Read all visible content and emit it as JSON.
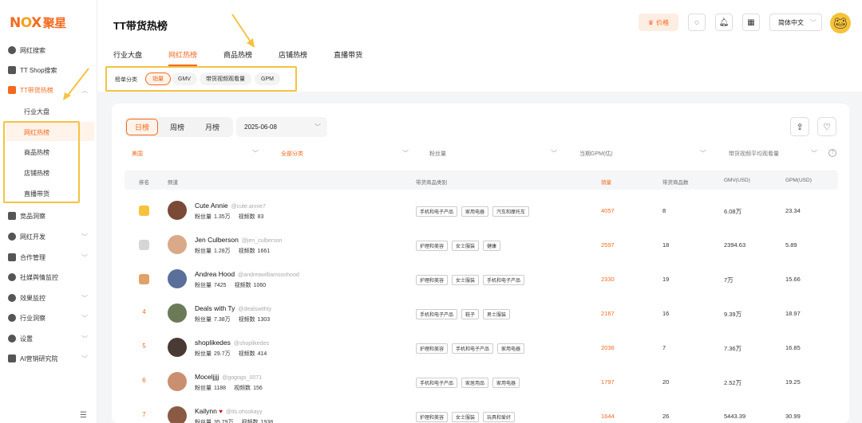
{
  "sidebar": {
    "logo_en": "NOX",
    "logo_cn": "聚星",
    "items": [
      {
        "label": "网红搜索",
        "icon": "compass-icon"
      },
      {
        "label": "TT Shop搜索",
        "icon": "shop-icon"
      },
      {
        "label": "TT带货热榜",
        "icon": "bar-chart-icon"
      },
      {
        "label": "竞品洞察",
        "icon": "r-badge-icon"
      },
      {
        "label": "网红开发",
        "icon": "users-icon"
      },
      {
        "label": "合作管理",
        "icon": "document-icon"
      },
      {
        "label": "社媒舆情监控",
        "icon": "monitor-icon"
      },
      {
        "label": "效果监控",
        "icon": "target-icon"
      },
      {
        "label": "行业洞察",
        "icon": "globe-icon"
      },
      {
        "label": "设置",
        "icon": "gear-icon"
      },
      {
        "label": "AI营销研究院",
        "icon": "ai-icon"
      }
    ],
    "sub_items": [
      "行业大盘",
      "网红热榜",
      "商品热榜",
      "店铺热榜",
      "直播带货"
    ]
  },
  "header": {
    "title": "TT带货热榜",
    "tabs": [
      "行业大盘",
      "网红热榜",
      "商品热榜",
      "店铺热榜",
      "直播带货"
    ],
    "price_label": "价格",
    "language": "简体中文"
  },
  "filter": {
    "label": "榜单分类",
    "chips": [
      "销量",
      "GMV",
      "带货视频观看量",
      "GPM"
    ]
  },
  "controls": {
    "periods": [
      "日榜",
      "周榜",
      "月榜"
    ],
    "date": "2025-06-08",
    "dropdowns": [
      "美国",
      "全部分类",
      "粉丝量",
      "当期GPM(估)",
      "带货视频平均观看量"
    ]
  },
  "table": {
    "headers": [
      "排名",
      "频道",
      "带货商品类别",
      "销量",
      "带货商品数",
      "GMV(USD)",
      "GPM(USD)"
    ],
    "fans_label": "粉丝量",
    "videos_label": "视频数",
    "rows": [
      {
        "rank": "1",
        "name": "Cute Annie",
        "handle": "@cute.annie7",
        "fans": "1.35万",
        "videos": "83",
        "tags": [
          "手机和电子产品",
          "家用电器",
          "汽车和摩托车"
        ],
        "sales": "4057",
        "items": "8",
        "gmv": "6.08万",
        "gpm": "23.34",
        "av_color": "#7a4a36"
      },
      {
        "rank": "2",
        "name": "Jen Culberson",
        "handle": "@jen_culberson",
        "fans": "1.28万",
        "videos": "1661",
        "tags": [
          "护理和美容",
          "女士服装",
          "健康"
        ],
        "sales": "2597",
        "items": "18",
        "gmv": "2394.63",
        "gpm": "5.89",
        "av_color": "#d9a98a"
      },
      {
        "rank": "3",
        "name": "Andrea Hood",
        "handle": "@andreawilliamsonhood",
        "fans": "7425",
        "videos": "1060",
        "tags": [
          "护理和美容",
          "女士服装",
          "手机和电子产品"
        ],
        "sales": "2330",
        "items": "19",
        "gmv": "7万",
        "gpm": "15.66",
        "av_color": "#5a6f9a"
      },
      {
        "rank": "4",
        "name": "Deals with Ty",
        "handle": "@dealswithty",
        "fans": "7.38万",
        "videos": "1303",
        "tags": [
          "手机和电子产品",
          "鞋子",
          "男士服装"
        ],
        "sales": "2167",
        "items": "16",
        "gmv": "9.39万",
        "gpm": "18.97",
        "av_color": "#6b7b58"
      },
      {
        "rank": "5",
        "name": "shoplikedes",
        "handle": "@shoplikedes",
        "fans": "29.7万",
        "videos": "414",
        "tags": [
          "护理和美容",
          "手机和电子产品",
          "家用电器"
        ],
        "sales": "2036",
        "items": "7",
        "gmv": "7.36万",
        "gpm": "16.85",
        "av_color": "#4a3a34"
      },
      {
        "rank": "6",
        "name": "Moceljjjj",
        "handle": "@gogogo_0071",
        "fans": "1188",
        "videos": "156",
        "tags": [
          "手机和电子产品",
          "家居用品",
          "家用电器"
        ],
        "sales": "1797",
        "items": "20",
        "gmv": "2.52万",
        "gpm": "19.25",
        "av_color": "#c98f70"
      },
      {
        "rank": "7",
        "name": "Kailynn",
        "handle": "@its.ohsokayy",
        "fans": "35.79万",
        "videos": "1938",
        "tags": [
          "护理和美容",
          "女士服装",
          "玩具和爱好"
        ],
        "sales": "1644",
        "items": "26",
        "gmv": "5443.39",
        "gpm": "30.99",
        "av_color": "#8a5a44"
      }
    ]
  }
}
